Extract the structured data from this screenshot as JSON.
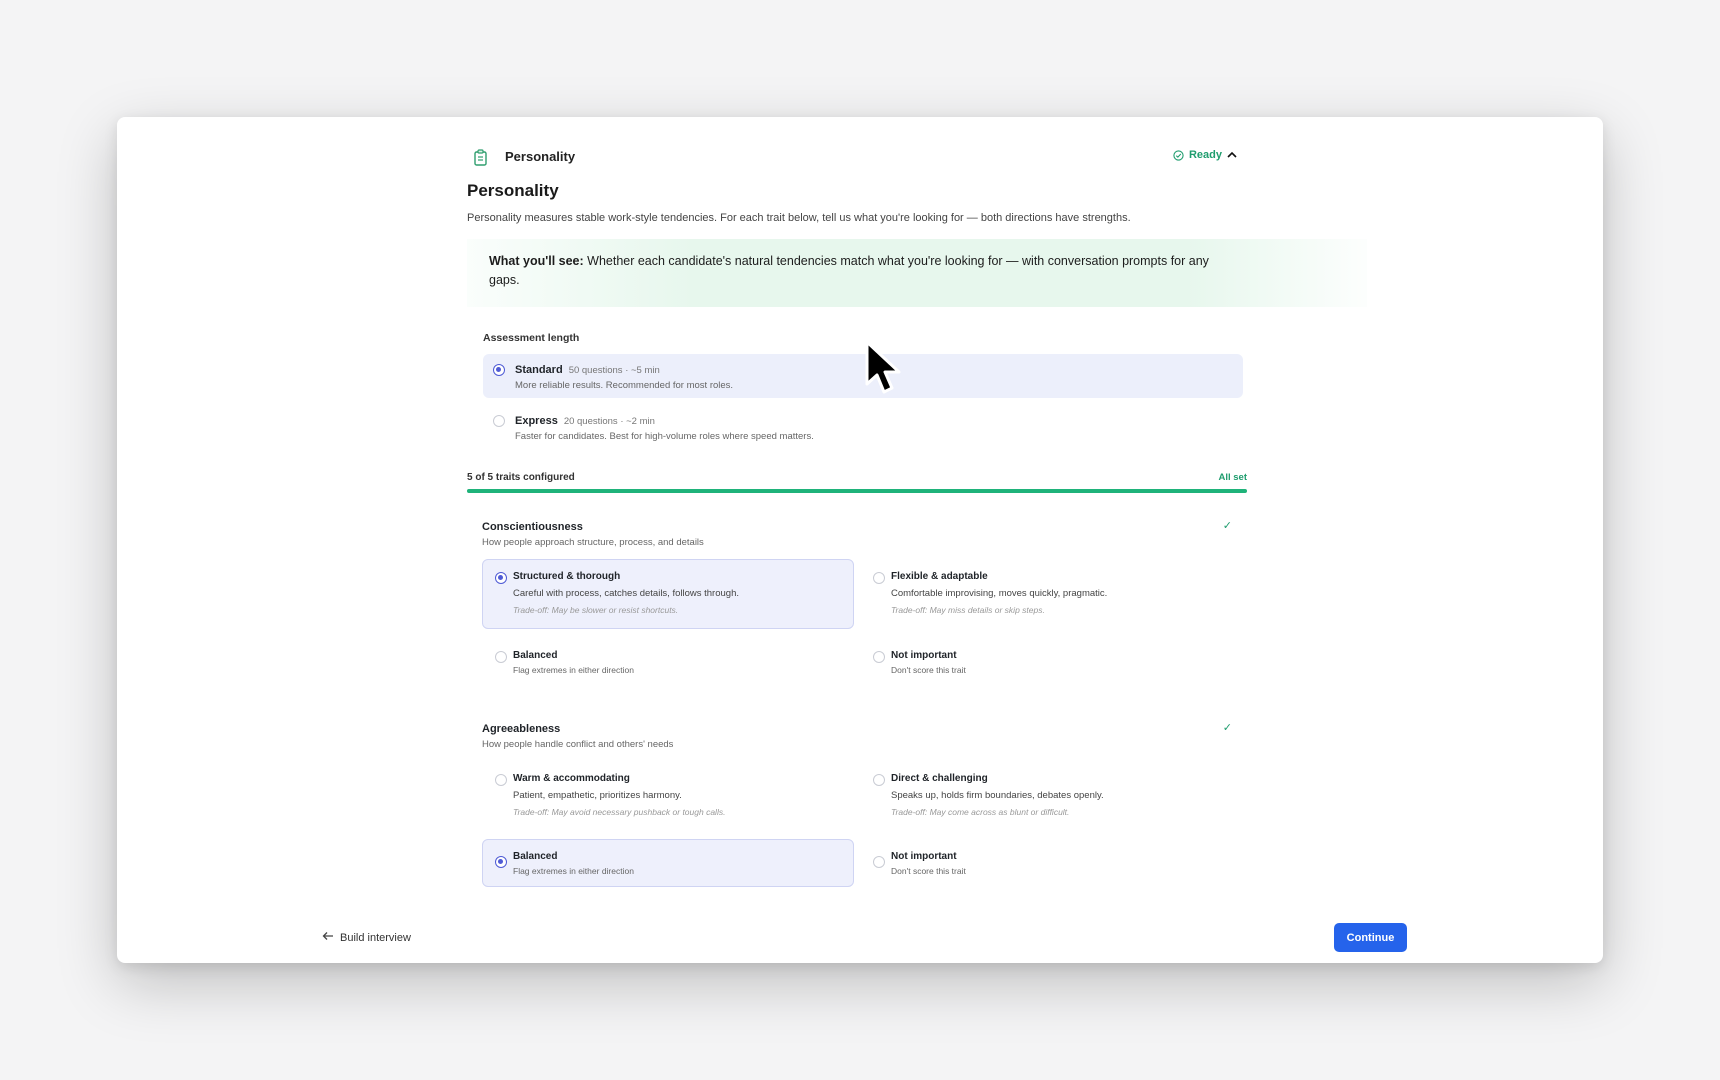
{
  "header": {
    "title": "Personality",
    "status": "Ready",
    "status_icon": "check-circle-icon",
    "toggle_icon": "chevron-up-icon"
  },
  "page": {
    "title": "Personality",
    "intro": "Personality measures stable work-style tendencies. For each trait below, tell us what you're looking for — both directions have strengths."
  },
  "banner": {
    "lead": "What you'll see:",
    "text": "Whether each candidate's natural tendencies match what you're looking for — with conversation prompts for any gaps."
  },
  "assessment_length": {
    "label": "Assessment length",
    "options": [
      {
        "name": "Standard",
        "meta": "50 questions · ~5 min",
        "desc": "More reliable results. Recommended for most roles.",
        "selected": true
      },
      {
        "name": "Express",
        "meta": "20 questions · ~2 min",
        "desc": "Faster for candidates. Best for high-volume roles where speed matters.",
        "selected": false
      }
    ]
  },
  "progress": {
    "label": "5 of 5 traits configured",
    "status": "All set",
    "configured": 5,
    "total": 5
  },
  "traits": [
    {
      "name": "Conscientiousness",
      "desc": "How people approach structure, process, and details",
      "check": "✓",
      "options": [
        {
          "title": "Structured & thorough",
          "desc": "Careful with process, catches details, follows through.",
          "tradeoff": "Trade-off: May be slower or resist shortcuts.",
          "selected": true
        },
        {
          "title": "Flexible & adaptable",
          "desc": "Comfortable improvising, moves quickly, pragmatic.",
          "tradeoff": "Trade-off: May miss details or skip steps.",
          "selected": false
        },
        {
          "title": "Balanced",
          "desc": "Flag extremes in either direction",
          "selected": false
        },
        {
          "title": "Not important",
          "desc": "Don't score this trait",
          "selected": false
        }
      ]
    },
    {
      "name": "Agreeableness",
      "desc": "How people handle conflict and others' needs",
      "check": "✓",
      "options": [
        {
          "title": "Warm & accommodating",
          "desc": "Patient, empathetic, prioritizes harmony.",
          "tradeoff": "Trade-off: May avoid necessary pushback or tough calls.",
          "selected": false
        },
        {
          "title": "Direct & challenging",
          "desc": "Speaks up, holds firm boundaries, debates openly.",
          "tradeoff": "Trade-off: May come across as blunt or difficult.",
          "selected": false
        },
        {
          "title": "Balanced",
          "desc": "Flag extremes in either direction",
          "selected": true
        },
        {
          "title": "Not important",
          "desc": "Don't score this trait",
          "selected": false
        }
      ]
    }
  ],
  "footer": {
    "back_label": "Build interview",
    "continue_label": "Continue"
  },
  "colors": {
    "accent": "#4f5bd5",
    "success": "#1f9d6e",
    "primary_button": "#2563eb",
    "selected_bg": "#eceffb",
    "banner_bg": "#e7f7ed"
  }
}
